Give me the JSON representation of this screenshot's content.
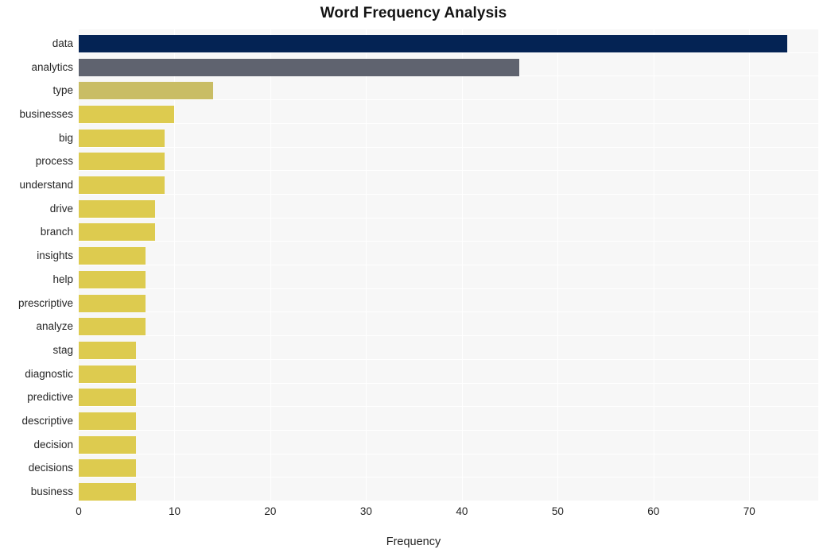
{
  "chart_data": {
    "type": "bar",
    "orientation": "horizontal",
    "title": "Word Frequency Analysis",
    "xlabel": "Frequency",
    "ylabel": "",
    "categories": [
      "data",
      "analytics",
      "type",
      "businesses",
      "big",
      "process",
      "understand",
      "drive",
      "branch",
      "insights",
      "help",
      "prescriptive",
      "analyze",
      "stag",
      "diagnostic",
      "predictive",
      "descriptive",
      "decision",
      "decisions",
      "business"
    ],
    "values": [
      74,
      46,
      14,
      10,
      9,
      9,
      9,
      8,
      8,
      7,
      7,
      7,
      7,
      6,
      6,
      6,
      6,
      6,
      6,
      6
    ],
    "xlim": [
      0,
      77.2
    ],
    "xticks": [
      0,
      10,
      20,
      30,
      40,
      50,
      60,
      70
    ],
    "xtick_labels": [
      "0",
      "10",
      "20",
      "30",
      "40",
      "50",
      "60",
      "70"
    ],
    "grid": true,
    "grid_color": "#ffffff",
    "legend": "none",
    "plot_background": "#f7f7f7",
    "figure_background": "#ffffff",
    "bar_colors": [
      "#042354",
      "#5f636f",
      "#c9bd65",
      "#ddcb4f",
      "#ddcb4f",
      "#ddcb4f",
      "#ddcb4f",
      "#ddcb4f",
      "#ddcb4f",
      "#ddcb4f",
      "#ddcb4f",
      "#ddcb4f",
      "#ddcb4f",
      "#ddcb4f",
      "#ddcb4f",
      "#ddcb4f",
      "#ddcb4f",
      "#ddcb4f",
      "#ddcb4f",
      "#ddcb4f"
    ]
  }
}
